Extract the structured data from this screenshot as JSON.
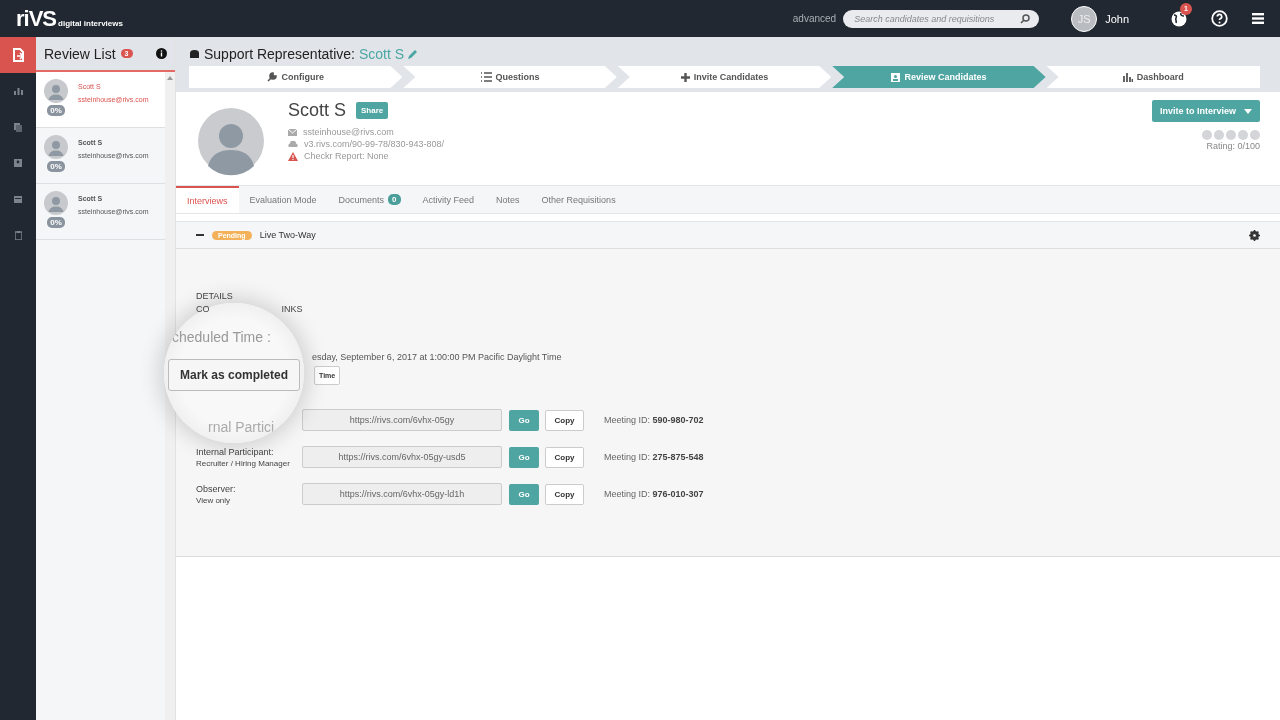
{
  "topbar": {
    "logo": "riVS",
    "logo_sub": "digital interviews",
    "advanced": "advanced",
    "search": {
      "placeholder": "Search candidates and requisitions"
    },
    "user": {
      "initials": "JS",
      "name": "John"
    },
    "notifications": "1"
  },
  "rail": [
    {
      "selected": true
    },
    {
      "selected": false
    },
    {
      "selected": false
    },
    {
      "selected": false
    },
    {
      "selected": false
    },
    {
      "selected": false
    }
  ],
  "review_list": {
    "title": "Review List",
    "count": "3",
    "items": [
      {
        "name": "Scott S",
        "email": "ssteinhouse@rivs.com",
        "progress": "0%",
        "selected": true
      },
      {
        "name": "Scott S",
        "email": "ssteinhouse@rivs.com",
        "progress": "0%",
        "selected": false
      },
      {
        "name": "Scott S",
        "email": "ssteinhouse@rivs.com",
        "progress": "0%",
        "selected": false
      }
    ]
  },
  "header": {
    "title": "Support Representative:",
    "candidate": "Scott S"
  },
  "steps": [
    {
      "label": "Configure",
      "selected": false
    },
    {
      "label": "Questions",
      "selected": false
    },
    {
      "label": "Invite Candidates",
      "selected": false
    },
    {
      "label": "Review Candidates",
      "selected": true
    },
    {
      "label": "Dashboard",
      "selected": false
    }
  ],
  "profile": {
    "name": "Scott S",
    "share": "Share",
    "email": "ssteinhouse@rivs.com",
    "link": "v3.rivs.com/90-99-78/830-943-808/",
    "checkr": "Checkr Report: None",
    "invite": "Invite to Interview",
    "stars": 0,
    "rating": "Rating: 0/100"
  },
  "tabs": [
    {
      "label": "Interviews",
      "selected": true
    },
    {
      "label": "Evaluation Mode",
      "selected": false
    },
    {
      "label": "Documents",
      "badge": "0",
      "selected": false
    },
    {
      "label": "Activity Feed",
      "selected": false
    },
    {
      "label": "Notes",
      "selected": false
    },
    {
      "label": "Other Requisitions",
      "selected": false
    }
  ],
  "interview": {
    "status": "Pending",
    "type": "Live Two-Way",
    "expanded": true
  },
  "details": {
    "heading": "DETAILS",
    "links_heading_start": "CO",
    "links_heading_end": "INKS",
    "date": "esday, September 6, 2017 at 1:00:00 PM Pacific Daylight Time",
    "time_button": "Time",
    "links": [
      {
        "url": "https://rivs.com/6vhx-05gy",
        "go": "Go",
        "copy": "Copy",
        "meeting_label": "Meeting ID:",
        "meeting_id": "590-980-702"
      },
      {
        "label": "Internal Participant:",
        "sublabel": "Recruiter / Hiring Manager",
        "url": "https://rivs.com/6vhx-05gy-usd5",
        "go": "Go",
        "copy": "Copy",
        "meeting_label": "Meeting ID:",
        "meeting_id": "275-875-548"
      },
      {
        "label": "Observer:",
        "sublabel": "View only",
        "url": "https://rivs.com/6vhx-05gy-ld1h",
        "go": "Go",
        "copy": "Copy",
        "meeting_label": "Meeting ID:",
        "meeting_id": "976-010-307"
      }
    ]
  },
  "magnifier": {
    "scheduled": "cheduled Time :",
    "button": "Mark as completed",
    "participant": "rnal Partici"
  }
}
